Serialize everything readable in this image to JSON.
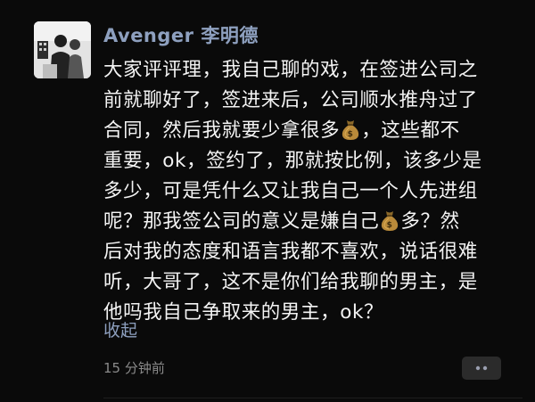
{
  "post": {
    "author": "Avenger 李明德",
    "lines": [
      [
        "大家评评理，我自己聊的戏，在签进公司之"
      ],
      [
        "前就聊好了，签进来后，公司顺水推舟过了"
      ],
      [
        "合同，然后我就要少拿很多",
        "，这些都不"
      ],
      [
        "重要，ok，签约了，那就按比例，该多少是"
      ],
      [
        "多少，可是凭什么又让我自己一个人先进组"
      ],
      [
        "呢？那我签公司的意义是嫌自己",
        "多？然"
      ],
      [
        "后对我的态度和语言我都不喜欢，说话很难"
      ],
      [
        "听，大哥了，这不是你们给我聊的男主，是"
      ],
      [
        "他吗我自己争取来的男主，ok？"
      ]
    ],
    "emoji_icon": "money-bag-icon",
    "collapse_label": "收起",
    "timestamp": "15 分钟前",
    "more_icon": "more-dots-icon"
  },
  "colors": {
    "background": "#0a0a0a",
    "name_link": "#8ea0bf",
    "body_text": "#f4f4f4",
    "meta_text": "#8a8a8a",
    "more_button_bg": "#2b2b2b"
  }
}
